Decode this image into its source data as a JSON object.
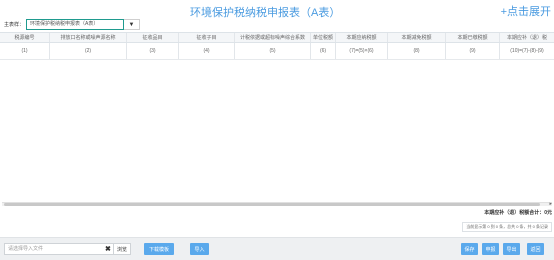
{
  "header": {
    "title": "环境保护税纳税申报表（A表）",
    "expand_label": "+点击展开"
  },
  "table_select": {
    "label": "主表样：",
    "value": "环境保护税纳税申报表（A表）"
  },
  "grid": {
    "columns": [
      "税源编号",
      "排放口名称或噪声源名称",
      "征收品目",
      "征收子目",
      "计税依据或超标噪声综合系数",
      "单位税额",
      "本期应纳税额",
      "本期减免税额",
      "本期已缴税额",
      "本期应补（退）税"
    ],
    "index_row": [
      "(1)",
      "(2)",
      "(3)",
      "(4)",
      "(5)",
      "(6)",
      "(7)=(5)×(6)",
      "(8)",
      "(9)",
      "(10)=(7)-(8)-(9)"
    ]
  },
  "summary": {
    "total_label": "本期应补（退）税额合计：0元",
    "pager_text": "当前显示第 0 到 0 条，总共 0 条，共 0 条记录"
  },
  "footer": {
    "file_placeholder": "请选择导入文件",
    "browse_label": "浏览",
    "download_template_label": "下载模板",
    "import_label": "导入",
    "save_label": "保存",
    "declare_label": "申报",
    "export_label": "导出",
    "back_label": "返回"
  },
  "colors": {
    "accent": "#5aa9ec",
    "title": "#4a9be0",
    "select_border": "#1f9b8f"
  }
}
